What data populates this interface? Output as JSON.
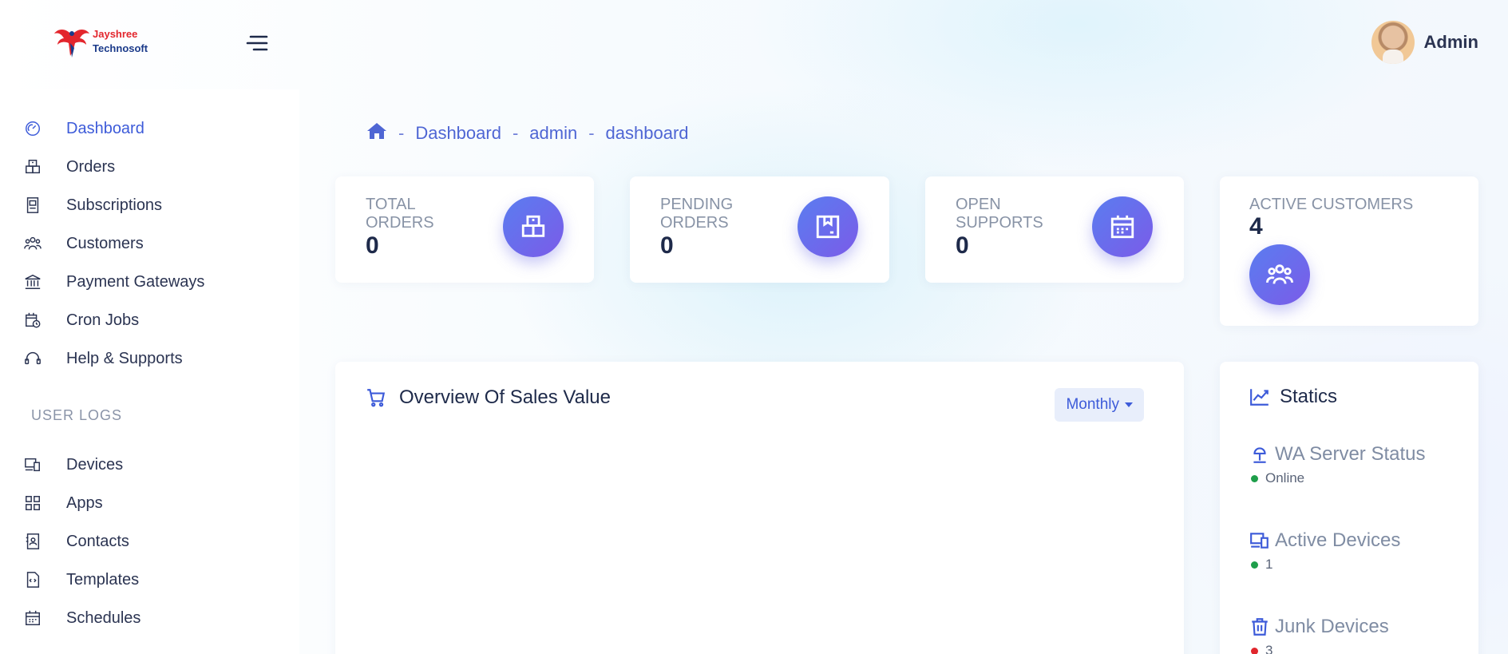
{
  "brand": {
    "line1": "Jayshree",
    "line2": "Technosoft"
  },
  "profile": {
    "name": "Admin"
  },
  "sidebar": {
    "items": [
      {
        "label": "Dashboard",
        "icon": "gauge-icon"
      },
      {
        "label": "Orders",
        "icon": "boxes-icon"
      },
      {
        "label": "Subscriptions",
        "icon": "receipt-icon"
      },
      {
        "label": "Customers",
        "icon": "users-icon"
      },
      {
        "label": "Payment Gateways",
        "icon": "bank-icon"
      },
      {
        "label": "Cron Jobs",
        "icon": "calendar-clock-icon"
      },
      {
        "label": "Help & Supports",
        "icon": "headset-icon"
      }
    ],
    "section_label": "USER LOGS",
    "log_items": [
      {
        "label": "Devices",
        "icon": "devices-icon"
      },
      {
        "label": "Apps",
        "icon": "grid-icon"
      },
      {
        "label": "Contacts",
        "icon": "contact-book-icon"
      },
      {
        "label": "Templates",
        "icon": "template-icon"
      },
      {
        "label": "Schedules",
        "icon": "calendar-icon"
      }
    ]
  },
  "breadcrumb": {
    "items": [
      "Dashboard",
      "admin",
      "dashboard"
    ],
    "separator": "-"
  },
  "stats": [
    {
      "label_line1": "TOTAL",
      "label_line2": "ORDERS",
      "value": "0",
      "icon": "boxes-icon"
    },
    {
      "label_line1": "PENDING",
      "label_line2": "ORDERS",
      "value": "0",
      "icon": "package-icon"
    },
    {
      "label_line1": "OPEN",
      "label_line2": "SUPPORTS",
      "value": "0",
      "icon": "calendar-icon"
    },
    {
      "label_line1": "ACTIVE CUSTOMERS",
      "label_line2": "",
      "value": "4",
      "icon": "users-icon"
    }
  ],
  "sales": {
    "title": "Overview Of Sales Value",
    "period": "Monthly"
  },
  "statics": {
    "title": "Statics",
    "rows": [
      {
        "label": "WA Server Status",
        "value": "Online",
        "status_color": "#1e9e4a",
        "icon": "server-icon"
      },
      {
        "label": "Active Devices",
        "value": "1",
        "status_color": "#1e9e4a",
        "icon": "devices-icon"
      },
      {
        "label": "Junk Devices",
        "value": "3",
        "status_color": "#e0262d",
        "icon": "trash-icon"
      }
    ]
  },
  "colors": {
    "accent": "#3d5bd9",
    "icon_gradient_start": "#5a7df0",
    "icon_gradient_end": "#7b5be8"
  }
}
